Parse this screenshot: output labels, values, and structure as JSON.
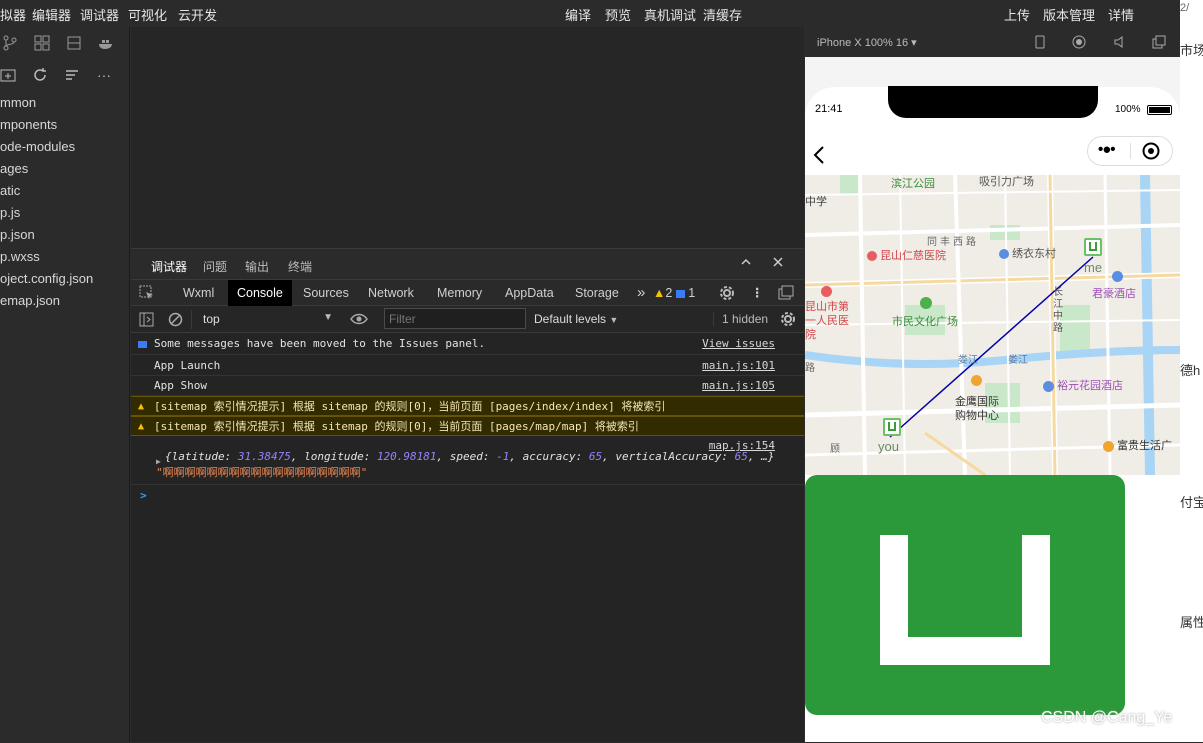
{
  "menubar": {
    "left": [
      "拟器",
      "编辑器",
      "调试器",
      "可视化",
      "云开发"
    ],
    "center": [
      "编译",
      "预览",
      "真机调试",
      "清缓存"
    ],
    "right": [
      "上传",
      "版本管理",
      "详情"
    ],
    "corner": "2/"
  },
  "file_tree": [
    "mmon",
    "mponents",
    "ode-modules",
    "ages",
    "atic",
    "p.js",
    "p.json",
    "p.wxss",
    "oject.config.json",
    "emap.json"
  ],
  "devtools": {
    "top_tabs": [
      "调试器",
      "问题",
      "输出",
      "终端"
    ],
    "cdp_tabs": [
      "Wxml",
      "Console",
      "Sources",
      "Network",
      "Memory",
      "AppData",
      "Storage"
    ],
    "more": "»",
    "warn_count": "2",
    "info_count": "1",
    "context": "top",
    "filter_placeholder": "Filter",
    "levels": "Default levels",
    "hidden": "1 hidden"
  },
  "console": {
    "issues_msg": "Some messages have been moved to the Issues panel.",
    "issues_link": "View issues",
    "launch": "App Launch",
    "launch_src": "main.js:101",
    "show": "App Show",
    "show_src": "main.js:105",
    "warn1": "[sitemap 索引情况提示] 根据 sitemap 的规则[0]，当前页面 [pages/index/index] 将被索引",
    "warn2": "[sitemap 索引情况提示] 根据 sitemap 的规则[0]，当前页面 [pages/map/map] 将被索引",
    "map_src": "map.js:154",
    "obj_open": "{",
    "k_lat": "latitude: ",
    "v_lat": "31.38475",
    "k_lng": ", longitude: ",
    "v_lng": "120.98181",
    "k_spd": ", speed: ",
    "v_spd": "-1",
    "k_acc": ", accuracy: ",
    "v_acc": "65",
    "k_vacc": ", verticalAccuracy: ",
    "v_vacc": "65",
    "obj_tail": ", …}",
    "string_out": "\"啊啊啊啊啊啊啊啊啊啊啊啊啊啊啊啊啊啊\"",
    "prompt": ">"
  },
  "simulator": {
    "device": "iPhone X 100% 16 ▾",
    "time": "21:41",
    "battery": "100%"
  },
  "map": {
    "labels": [
      "滨江公园",
      "吸引力广场",
      "中学",
      "同丰西路",
      "昆山仁慈医院",
      "绣衣东村",
      "me",
      "昆山市第一人民医院",
      "市民文化广场",
      "长江中路",
      "君豪酒店",
      "娄江",
      "娄江",
      "金鹰国际",
      "购物中心",
      "裕元花园酒店",
      "you",
      "富贵生活广",
      "路",
      "顾"
    ],
    "route": "route-line"
  },
  "right_strip": [
    "市场",
    "德h",
    "付宝",
    "属性"
  ],
  "watermark": "CSDN @Cang_Ye",
  "colors": {
    "accent_green": "#2b9939",
    "route": "#0000aa",
    "warning_bg": "#332b00"
  }
}
